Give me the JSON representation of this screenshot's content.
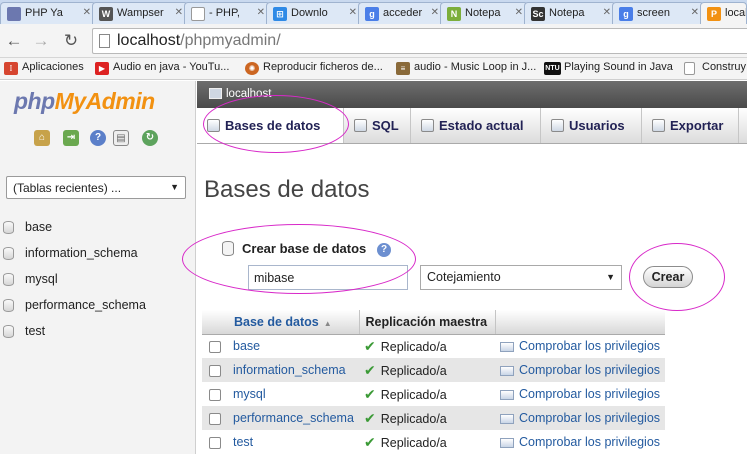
{
  "browser": {
    "tabs": [
      {
        "title": "PHP Ya",
        "icon": "php-tab-icon",
        "color": "#6c78af"
      },
      {
        "title": "Wampser",
        "icon": "wamp-tab-icon",
        "color": "#555555"
      },
      {
        "title": "- PHP,",
        "icon": "page-tab-icon",
        "color": "#9a9a9a"
      },
      {
        "title": "Downlo",
        "icon": "windows-tab-icon",
        "color": "#2f8ae6"
      },
      {
        "title": "acceder",
        "icon": "google-tab-icon",
        "color": "#4a7ee8"
      },
      {
        "title": "Notepa",
        "icon": "notepad-tab-icon",
        "color": "#7cae3b"
      },
      {
        "title": "Notepa",
        "icon": "sc-tab-icon",
        "color": "#333333"
      },
      {
        "title": "screen",
        "icon": "google-tab-icon",
        "color": "#4a7ee8"
      },
      {
        "title": "local",
        "icon": "pma-tab-icon",
        "color": "#f29111"
      }
    ],
    "url_host": "localhost",
    "url_path": "/phpmyadmin/",
    "bookmarks": [
      {
        "label": "Aplicaciones",
        "icon": "apps-icon",
        "color": "#d6452f"
      },
      {
        "label": "Audio en java - YouTu...",
        "icon": "youtube-icon",
        "color": "#d22"
      },
      {
        "label": "Reproducir ficheros de...",
        "icon": "flame-icon",
        "color": "#c62"
      },
      {
        "label": "audio - Music Loop in J...",
        "icon": "stack-icon",
        "color": "#8a6a3a"
      },
      {
        "label": "Playing Sound in Java",
        "icon": "ntu-icon",
        "color": "#111"
      },
      {
        "label": "Construy",
        "icon": "page-icon",
        "color": "#bbb"
      }
    ]
  },
  "sidebar": {
    "logo_php": "php",
    "logo_myadmin": "MyAdmin",
    "recent_select": "(Tablas recientes) ...",
    "databases": [
      "base",
      "information_schema",
      "mysql",
      "performance_schema",
      "test"
    ]
  },
  "main": {
    "server_label": "localhost",
    "tabs": [
      {
        "label": "Bases de datos",
        "active": true
      },
      {
        "label": "SQL",
        "active": false
      },
      {
        "label": "Estado actual",
        "active": false
      },
      {
        "label": "Usuarios",
        "active": false
      },
      {
        "label": "Exportar",
        "active": false
      }
    ],
    "page_title": "Bases de datos",
    "create": {
      "label": "Crear base de datos",
      "input_value": "mibase",
      "collation": "Cotejamiento",
      "button": "Crear"
    },
    "table": {
      "headers": [
        "Base de datos",
        "Replicación maestra"
      ],
      "rows": [
        {
          "name": "base",
          "replication": "Replicado/a",
          "privileges": "Comprobar los privilegios"
        },
        {
          "name": "information_schema",
          "replication": "Replicado/a",
          "privileges": "Comprobar los privilegios"
        },
        {
          "name": "mysql",
          "replication": "Replicado/a",
          "privileges": "Comprobar los privilegios"
        },
        {
          "name": "performance_schema",
          "replication": "Replicado/a",
          "privileges": "Comprobar los privilegios"
        },
        {
          "name": "test",
          "replication": "Replicado/a",
          "privileges": "Comprobar los privilegios"
        }
      ]
    }
  },
  "colors": {
    "annotation": "#d829c9",
    "link": "#235a9f",
    "tick": "#3b9a36",
    "pma_orange": "#f29111",
    "pma_blue": "#6c78af"
  }
}
